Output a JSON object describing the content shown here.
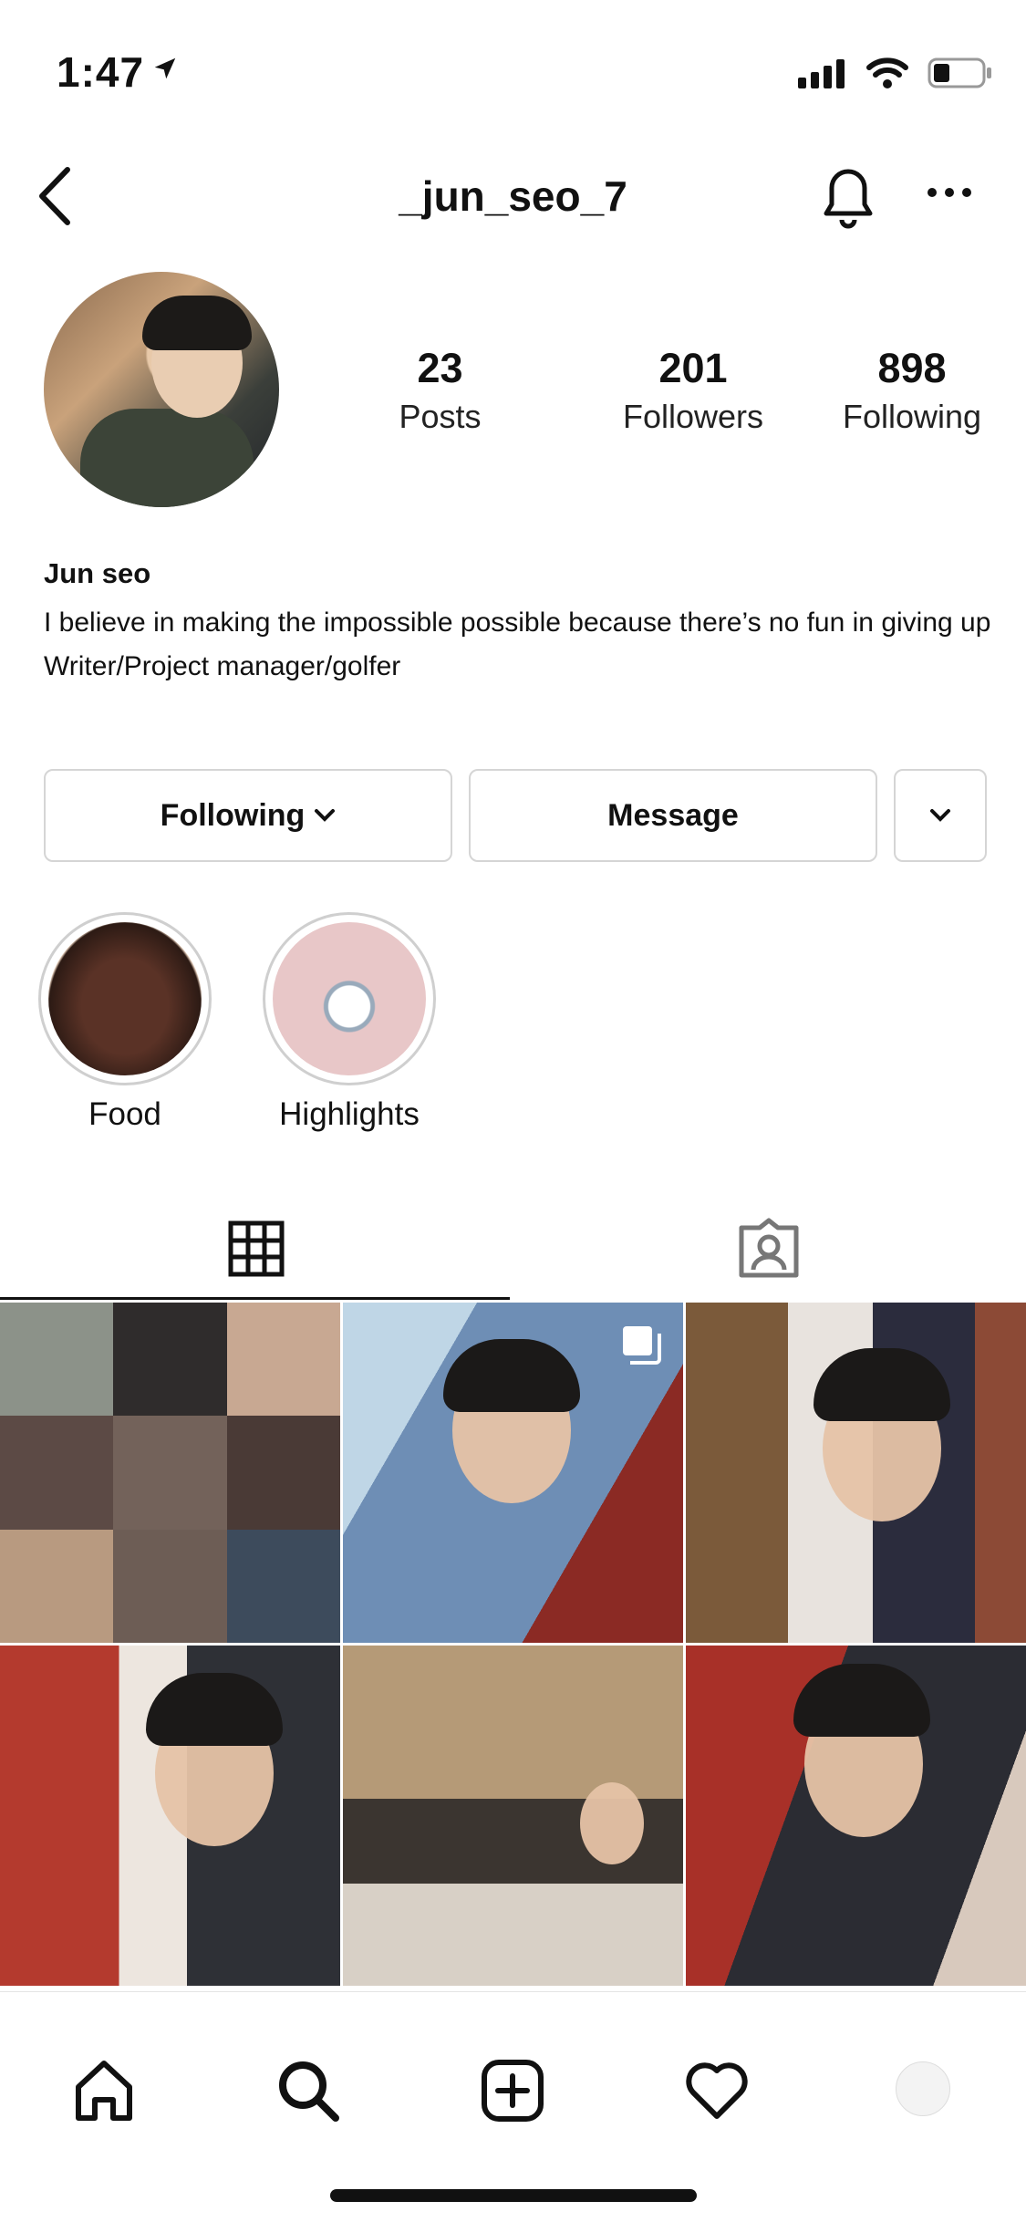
{
  "status_bar": {
    "time": "1:47",
    "battery_level": 0.3
  },
  "header": {
    "username": "_jun_seo_7"
  },
  "profile": {
    "stats": [
      {
        "value": "23",
        "label": "Posts"
      },
      {
        "value": "201",
        "label": "Followers"
      },
      {
        "value": "898",
        "label": "Following"
      }
    ],
    "name": "Jun seo",
    "bio_line1": "I believe in making the impossible possible because there’s no fun in giving up",
    "bio_line2": "Writer/Project manager/golfer"
  },
  "actions": {
    "following_label": "Following",
    "message_label": "Message"
  },
  "highlights": [
    {
      "label": "Food"
    },
    {
      "label": "Highlights"
    }
  ],
  "tabs": [
    "grid-icon",
    "tagged-icon"
  ],
  "bottom_nav": [
    "home-icon",
    "search-icon",
    "add-icon",
    "heart-icon",
    "profile-avatar"
  ],
  "colors": {
    "text": "#111111",
    "border": "#d5d5d5"
  }
}
